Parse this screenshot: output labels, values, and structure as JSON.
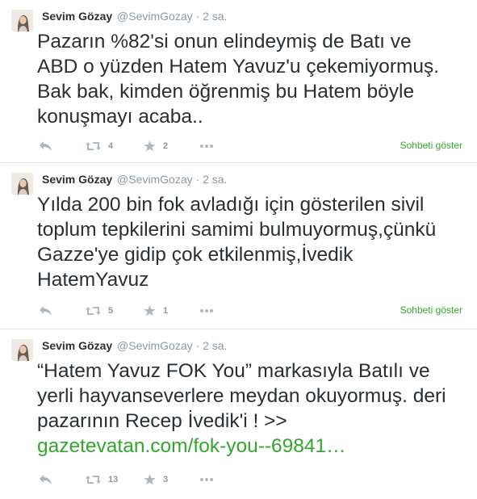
{
  "tweets": [
    {
      "fullname": "Sevim Gözay",
      "username": "@SevimGozay",
      "separator": "·",
      "time": "2 sa.",
      "text": "Pazarın %82'si onun elindeymiş de Batı ve\nABD o yüzden Hatem Yavuz'u çekemiyormuş.\nBak bak, kimden öğrenmiş bu Hatem böyle\nkonuşmayı acaba..",
      "link": "",
      "retweets": "4",
      "favorites": "2",
      "conversation": "Sohbeti göster"
    },
    {
      "fullname": "Sevim Gözay",
      "username": "@SevimGozay",
      "separator": "·",
      "time": "2 sa.",
      "text": "Yılda 200 bin fok avladığı için gösterilen sivil\ntoplum tepkilerini samimi bulmuyormuş,çünkü\nGazze'ye gidip çok etkilenmiş,İvedik\nHatemYavuz",
      "link": "",
      "retweets": "5",
      "favorites": "1",
      "conversation": "Sohbeti göster"
    },
    {
      "fullname": "Sevim Gözay",
      "username": "@SevimGozay",
      "separator": "·",
      "time": "2 sa.",
      "text": "“Hatem Yavuz FOK You” markasıyla Batılı ve\nyerli hayvanseverlere meydan okuyormuş. deri\npazarının Recep İvedik'i ! >>\n",
      "link": "gazetevatan.com/fok-you--69841…",
      "retweets": "13",
      "favorites": "3",
      "conversation": ""
    }
  ],
  "icons": {
    "reply": "reply-icon",
    "retweet": "retweet-icon",
    "favorite": "star-icon",
    "more": "more-icon"
  },
  "colors": {
    "link": "#31a72c",
    "muted": "#8899a6",
    "icon": "#aab8c2",
    "text": "#292f33",
    "divider": "#e1e8ed"
  }
}
